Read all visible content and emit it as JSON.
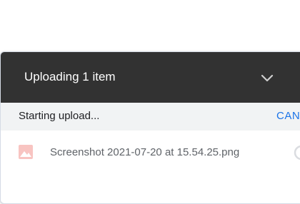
{
  "upload_panel": {
    "title": "Uploading 1 item",
    "collapse_icon": "chevron-down-icon",
    "status_text": "Starting upload...",
    "cancel_label": "CANCEL",
    "colors": {
      "header_bg": "#323232",
      "status_bg": "#f1f3f4",
      "accent": "#1a73e8",
      "file_icon": "#f4a7a3"
    },
    "files": [
      {
        "name": "Screenshot 2021-07-20 at 15.54.25.png",
        "icon": "image-file-icon",
        "status_icon": "progress-ring-icon"
      }
    ]
  }
}
